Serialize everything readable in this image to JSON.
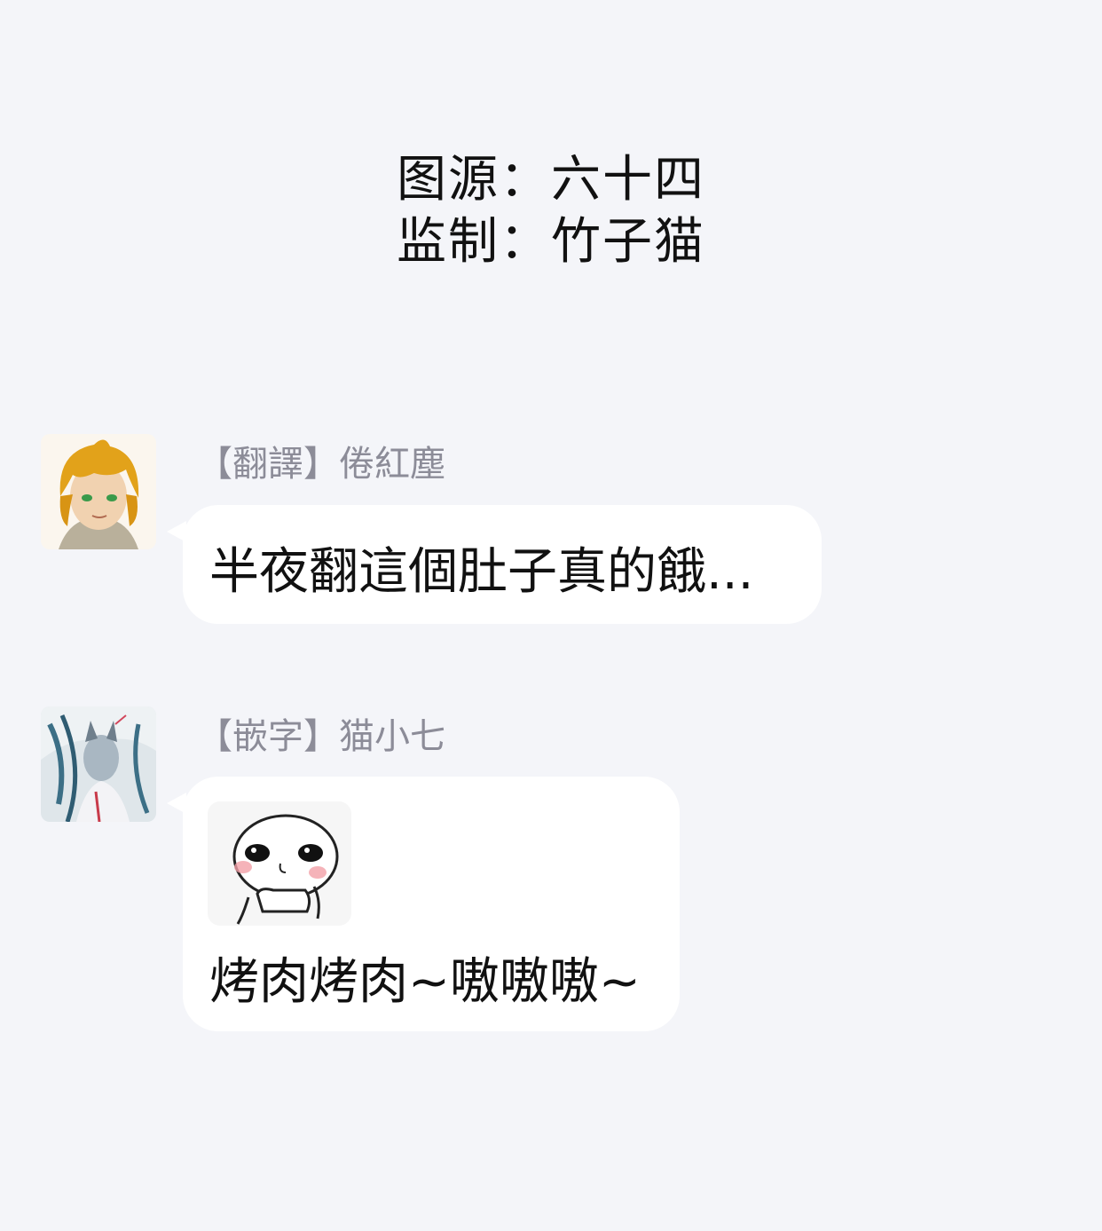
{
  "credits": {
    "line1": "图源：六十四",
    "line2": "监制：竹子猫"
  },
  "messages": [
    {
      "sender": "【翻譯】倦紅塵",
      "text": "半夜翻這個肚子真的餓..."
    },
    {
      "sender": "【嵌字】猫小七",
      "sticker": "blushing-face-sticker",
      "text": "烤肉烤肉~嗷嗷嗷~"
    }
  ]
}
